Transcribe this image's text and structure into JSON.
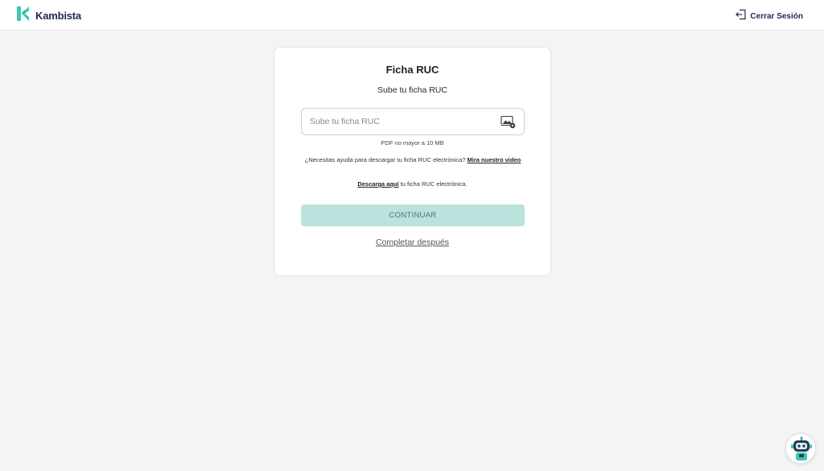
{
  "header": {
    "brand_name": "Kambista",
    "logout_label": "Cerrar Sesión"
  },
  "card": {
    "title": "Ficha RUC",
    "subtitle": "Sube tu ficha RUC",
    "upload_placeholder": "Sube tu ficha RUC",
    "upload_hint": "PDF no mayor a 10 MB",
    "help_text": "¿Necesitas ayuda para descargar tu ficha RUC electrónica?",
    "help_link": "Mira nuestro video",
    "download_link": "Descarga aquí",
    "download_text": "tu ficha RUC electrónica.",
    "continue_label": "CONTINUAR",
    "later_label": "Completar después"
  },
  "colors": {
    "brand_teal": "#3ec7b2",
    "brand_navy": "#1e2b4f",
    "continue_bg": "#b9e3dc",
    "page_bg": "#f4f4f6"
  },
  "icons": {
    "logo": "kambista-logo-icon",
    "logout": "logout-icon",
    "upload": "image-upload-icon",
    "chatbot": "robot-chat-icon"
  }
}
